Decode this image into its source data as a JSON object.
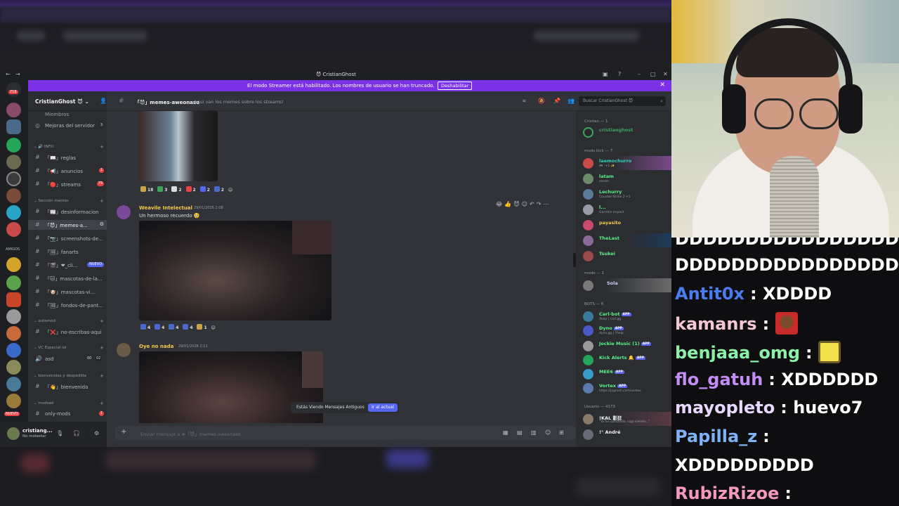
{
  "window": {
    "title": "CristianGhost",
    "title_emoji": "😈",
    "banner_message": "El modo Streamer está habilitado. Los nombres de usuario se han truncado.",
    "banner_button": "Deshabilitar"
  },
  "servers": {
    "top_badge": "718",
    "nuevo_label": "NUEVO",
    "folder_label": "AMIGOS"
  },
  "guild": {
    "name": "CristianGhost",
    "items": [
      {
        "label": "Miembros"
      },
      {
        "label": "Mejoras del servidor",
        "badge": "3"
      }
    ],
    "categories": [
      {
        "label": "INFO"
      },
      {
        "label": "Sección memes"
      },
      {
        "label": "automod"
      },
      {
        "label": "VC Especial lol"
      },
      {
        "label": "bienvenidas y despedida"
      },
      {
        "label": "modsad"
      }
    ],
    "channels": [
      {
        "label": "「📖」reglas"
      },
      {
        "label": "「📢」anuncios",
        "badge": "1"
      },
      {
        "label": "「🔴」streams",
        "badge": "79"
      },
      {
        "label": "「📰」desinformacion"
      },
      {
        "label": "「😈」memes-a...",
        "active": true
      },
      {
        "label": "「📷」screenshots-de..."
      },
      {
        "label": "「🖼」fanarts"
      },
      {
        "label": "「🎬」❤_cli...",
        "new": "NUEVO"
      },
      {
        "label": "「🐱」mascotas-de-la..."
      },
      {
        "label": "「🐶」mascotas-vi..."
      },
      {
        "label": "「🖼」fondos-de-pant..."
      },
      {
        "label": "「❌」no-escribas-aqui"
      },
      {
        "label": "asd",
        "voice": true,
        "counts": [
          "00",
          "02"
        ]
      },
      {
        "label": "「👋」bienvenida"
      },
      {
        "label": "only-mods",
        "badge": "1"
      }
    ]
  },
  "user_panel": {
    "name": "cristiang...",
    "status": "No molestar"
  },
  "channel_header": {
    "name": "「😈」memes-aweonaso",
    "topic": "Aquí van los memes sobre los streams!",
    "search_placeholder": "Buscar CristianGhost 😈"
  },
  "messages": [
    {
      "author": "",
      "reactions": [
        "18",
        "3",
        "2",
        "2",
        "2",
        "2"
      ]
    },
    {
      "author": "Weavile Intelectual",
      "timestamp": "29/01/2026 2:08",
      "text": "Un hermoso recuerdo 🥹",
      "reactions": [
        "4",
        "4",
        "4",
        "4",
        "1"
      ]
    },
    {
      "author": "Oye no nada",
      "timestamp": "29/01/2026 2:11",
      "text": ""
    }
  ],
  "jump_bar": {
    "text": "Estás Viendo Mensajes Antiguos",
    "button": "Ir al actual"
  },
  "composer": {
    "placeholder": "Enviar mensaje a #「😈」memes-aweonaso"
  },
  "members": {
    "groups": [
      {
        "label": "Cristian — 1"
      },
      {
        "label": "mods kick — 7"
      },
      {
        "label": "modo — 1"
      },
      {
        "label": "BOTS — 6"
      },
      {
        "label": "Usuario — 4173"
      }
    ],
    "list": [
      {
        "name": "cristianghost",
        "color": "#3ba55c"
      },
      {
        "name": "laemochurro",
        "status": "🎮 ·+1·✨",
        "color": "#2dd4bf"
      },
      {
        "name": "latam",
        "status": "steam",
        "color": "#57f287"
      },
      {
        "name": "Lechurry",
        "status": "Counter-Strike 2 +1",
        "color": "#57f287"
      },
      {
        "name": "l...",
        "status": "Genshin Impact",
        "color": "#57f287"
      },
      {
        "name": "payasito",
        "status": "",
        "color": "#f2c94c"
      },
      {
        "name": "TheLast",
        "status": "",
        "color": "#57f287"
      },
      {
        "name": "Tsukei",
        "status": "",
        "color": "#57f287"
      },
      {
        "name": "",
        "status": "Sola",
        "color": "#c9cdfb"
      },
      {
        "name": "Carl-bot",
        "status": "/help | carl.gg",
        "color": "#57f287",
        "app": "APP"
      },
      {
        "name": "Dyno",
        "status": "dyno.gg | ?help",
        "color": "#57f287",
        "app": "APP"
      },
      {
        "name": "Jockie Music (1)",
        "status": "",
        "color": "#57f287",
        "app": "APP"
      },
      {
        "name": "Kick Alerts 🔔",
        "status": "",
        "color": "#57f287",
        "app": "APP"
      },
      {
        "name": "MEE6",
        "status": "",
        "color": "#57f287",
        "app": "APP"
      },
      {
        "name": "Vortex",
        "status": "https://jagrosh.com/vortex",
        "color": "#57f287",
        "app": "APP"
      },
      {
        "name": "!KAL 影狂",
        "status": "\"Yo he cambiado, sigo siendo...\"",
        "color": "#f23f43"
      },
      {
        "name": "!° André",
        "status": "",
        "color": "#f2f3f5"
      }
    ]
  },
  "stream_chat": [
    {
      "nick": "",
      "message": "DDDDDDDDDDDDDDDD",
      "nick_color": "#ffffff"
    },
    {
      "nick": "",
      "message": "DDDDDDDDDDDDDDDD",
      "nick_color": "#ffffff"
    },
    {
      "nick": "Antit0x",
      "message": "XDDDD",
      "nick_color": "#4a7cf0"
    },
    {
      "nick": "kamanrs",
      "message": "",
      "nick_color": "#f4c7d4",
      "emote": "laughing-man-emote"
    },
    {
      "nick": "benjaaa_omg",
      "message": "",
      "nick_color": "#8cf0a8",
      "emote": "spongebob-emote"
    },
    {
      "nick": "flo_gatuh",
      "message": "XDDDDDD",
      "nick_color": "#c48cf5"
    },
    {
      "nick": "mayopleto",
      "message": "huevo7",
      "nick_color": "#e8d8ff"
    },
    {
      "nick": "Papilla_z",
      "message": "",
      "nick_color": "#7fb1f5"
    },
    {
      "nick": "",
      "message": "XDDDDDDDDD",
      "nick_color": "#ffffff"
    },
    {
      "nick": "RubizRizoe",
      "message": "",
      "nick_color": "#f598c0"
    }
  ]
}
